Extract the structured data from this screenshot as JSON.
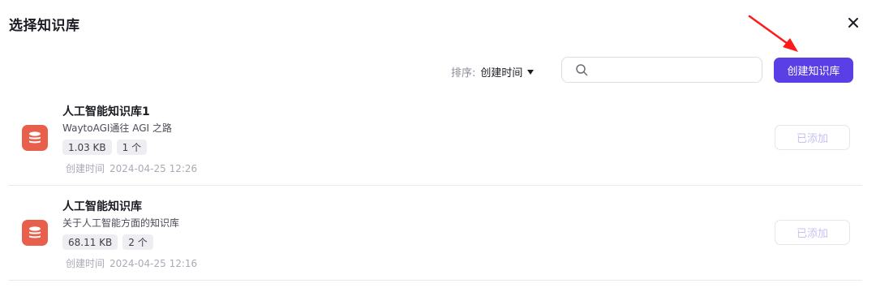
{
  "dialog": {
    "title": "选择知识库",
    "close_icon": "close-icon"
  },
  "toolbar": {
    "sort_label": "排序:",
    "sort_value": "创建时间",
    "search_placeholder": "",
    "search_value": "",
    "create_button": "创建知识库",
    "accent_color": "#5b3fe6"
  },
  "annotation": {
    "arrow_color": "#ff1a1a"
  },
  "knowledge_bases": [
    {
      "name": "人工智能知识库1",
      "description": "WaytoAGI通往 AGI 之路",
      "size": "1.03 KB",
      "count": "1 个",
      "created_label": "创建时间",
      "created_time": "2024-04-25 12:26",
      "status_button": "已添加",
      "icon": "database-icon",
      "icon_color": "#e8604c"
    },
    {
      "name": "人工智能知识库",
      "description": "关于人工智能方面的知识库",
      "size": "68.11 KB",
      "count": "2 个",
      "created_label": "创建时间",
      "created_time": "2024-04-25 12:16",
      "status_button": "已添加",
      "icon": "database-icon",
      "icon_color": "#e8604c"
    }
  ]
}
